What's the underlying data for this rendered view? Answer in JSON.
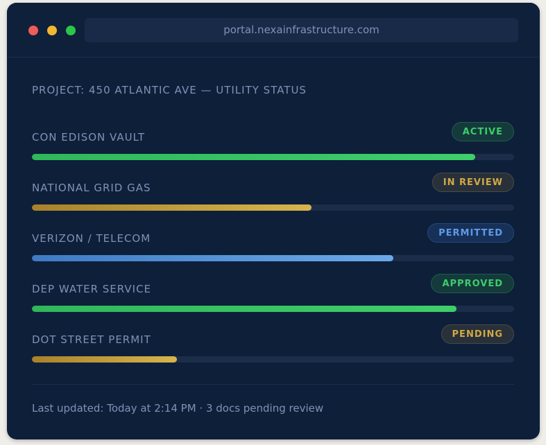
{
  "browser": {
    "url": "portal.nexainfrastructure.com"
  },
  "page": {
    "title": "PROJECT: 450 ATLANTIC AVE — UTILITY STATUS"
  },
  "utilities": [
    {
      "label": "CON EDISON VAULT",
      "status": "ACTIVE",
      "status_color": "#3dcd6c",
      "progress": 0.92
    },
    {
      "label": "NATIONAL GRID GAS",
      "status": "IN REVIEW",
      "status_color": "#d1a945",
      "progress": 0.58
    },
    {
      "label": "VERIZON / TELECOM",
      "status": "PERMITTED",
      "status_color": "#5f9ae7",
      "progress": 0.75
    },
    {
      "label": "DEP WATER SERVICE",
      "status": "APPROVED",
      "status_color": "#3dcd6c",
      "progress": 0.88
    },
    {
      "label": "DOT STREET PERMIT",
      "status": "PENDING",
      "status_color": "#d1a945",
      "progress": 0.3
    }
  ],
  "footer": {
    "text": "Last updated: Today at 2:14 PM · 3 docs pending review"
  }
}
